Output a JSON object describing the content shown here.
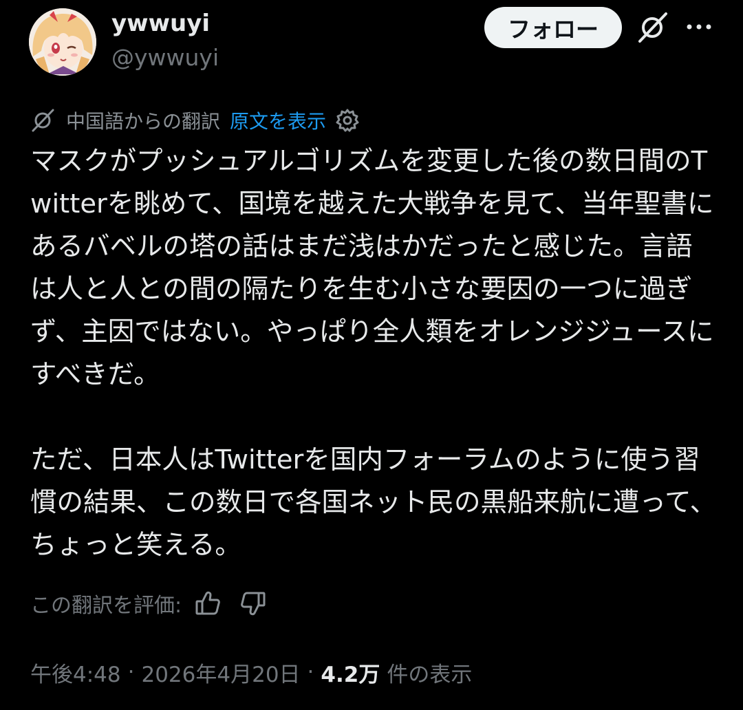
{
  "author": {
    "display_name": "ywwuyi",
    "handle": "@ywwuyi",
    "avatar_icon": "avatar-anime-character"
  },
  "actions": {
    "follow_label": "フォロー",
    "grok_icon": "grok-icon",
    "more_icon": "more-dots-icon"
  },
  "translation": {
    "from_label": "中国語からの翻訳",
    "show_original_label": "原文を表示",
    "settings_icon": "gear-icon"
  },
  "post": {
    "text": "マスクがプッシュアルゴリズムを変更した後の数日間のTwitterを眺めて、国境を越えた大戦争を見て、当年聖書にあるバベルの塔の話はまだ浅はかだったと感じた。言語は人と人との間の隔たりを生む小さな要因の一つに過ぎず、主因ではない。やっぱり全人類をオレンジジュースにすべきだ。\n\nただ、日本人はTwitterを国内フォーラムのように使う習慣の結果、この数日で各国ネット民の黒船来航に遭って、ちょっと笑える。"
  },
  "rating": {
    "label": "この翻訳を評価:",
    "up_icon": "thumbs-up-icon",
    "down_icon": "thumbs-down-icon"
  },
  "meta": {
    "time": "午後4:48",
    "separator": "·",
    "date": "2026年4月20日",
    "views_count": "4.2万",
    "views_label": "件の表示"
  },
  "colors": {
    "background": "#000000",
    "text": "#e7e9ea",
    "secondary": "#71767b",
    "link": "#1d9bf0",
    "button_bg": "#eff3f4"
  }
}
